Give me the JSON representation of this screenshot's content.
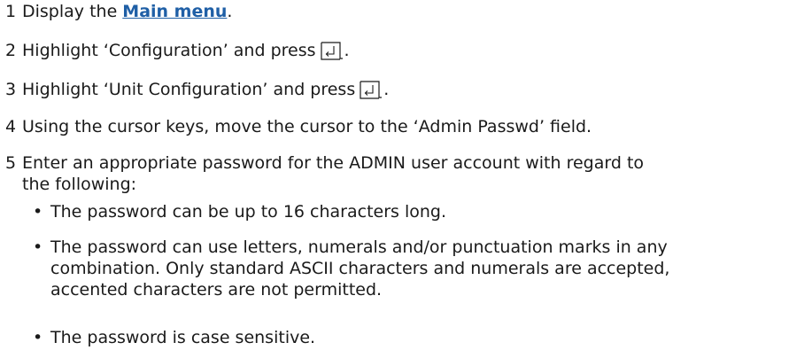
{
  "steps": [
    {
      "num": "1",
      "before": "Display the ",
      "link": "Main menu",
      "after": "."
    },
    {
      "num": "2",
      "text": "Highlight ‘Configuration’ and press",
      "after": "."
    },
    {
      "num": "3",
      "text": "Highlight ‘Unit Configuration’ and press",
      "after": "."
    },
    {
      "num": "4",
      "text": "Using the cursor keys, move the cursor to the ‘Admin Passwd’ field."
    },
    {
      "num": "5",
      "line1": "Enter an appropriate password for the ADMIN user account with regard to",
      "line2": "the following:"
    }
  ],
  "bullets": [
    {
      "glyph": "•",
      "lines": [
        "The password can be up to 16 characters long."
      ]
    },
    {
      "glyph": "•",
      "lines": [
        "The password can use letters, numerals and/or punctuation marks in any",
        "combination. Only standard ASCII characters and numerals are accepted,",
        "accented characters are not permitted."
      ]
    },
    {
      "glyph": "•",
      "lines": [
        "The password is case sensitive."
      ]
    }
  ],
  "icons": {
    "enter_key": "enter-key-icon"
  },
  "colors": {
    "text": "#1a1a1a",
    "link": "#1f5fa6"
  }
}
